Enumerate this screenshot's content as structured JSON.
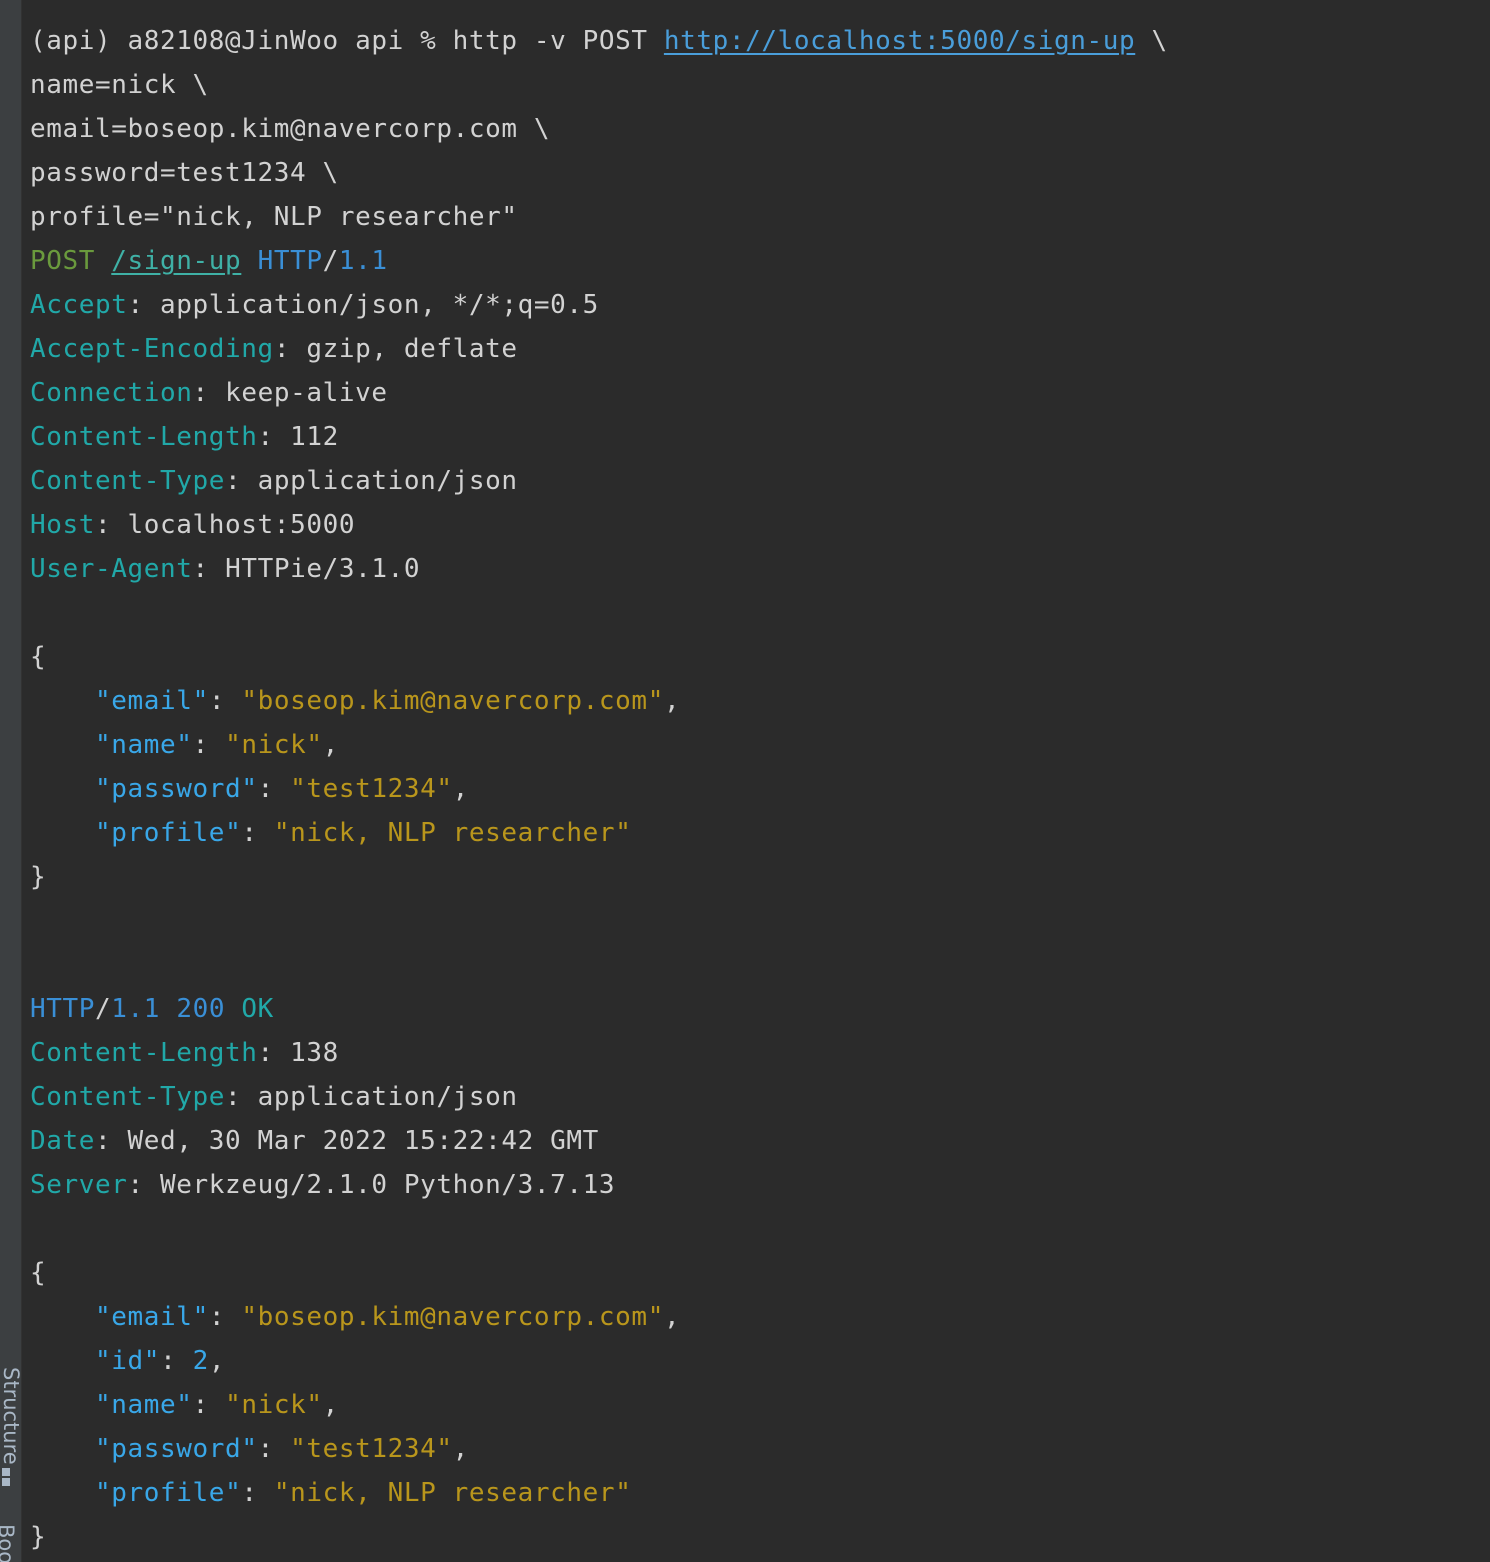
{
  "sidebar": {
    "structure_label": "Structure",
    "bookmarks_label": "Bookmarks"
  },
  "command": {
    "prompt": "(api) a82108@JinWoo api % ",
    "cmd": "http -v POST ",
    "url": "http://localhost:5000/sign-up",
    "cont": " \\",
    "args": [
      "name=nick \\",
      "email=boseop.kim@navercorp.com \\",
      "password=test1234 \\",
      "profile=\"nick, NLP researcher\""
    ]
  },
  "request": {
    "method": "POST",
    "path": "/sign-up",
    "protocol": "HTTP",
    "version": "1.1",
    "headers": [
      {
        "name": "Accept",
        "value": "application/json, */*;q=0.5"
      },
      {
        "name": "Accept-Encoding",
        "value": "gzip, deflate"
      },
      {
        "name": "Connection",
        "value": "keep-alive"
      },
      {
        "name": "Content-Length",
        "value": "112"
      },
      {
        "name": "Content-Type",
        "value": "application/json"
      },
      {
        "name": "Host",
        "value": "localhost:5000"
      },
      {
        "name": "User-Agent",
        "value": "HTTPie/3.1.0"
      }
    ],
    "body": [
      {
        "key": "email",
        "value": "boseop.kim@navercorp.com",
        "type": "string"
      },
      {
        "key": "name",
        "value": "nick",
        "type": "string"
      },
      {
        "key": "password",
        "value": "test1234",
        "type": "string"
      },
      {
        "key": "profile",
        "value": "nick, NLP researcher",
        "type": "string"
      }
    ]
  },
  "response": {
    "protocol": "HTTP",
    "version": "1.1",
    "status_code": "200",
    "status_text": "OK",
    "headers": [
      {
        "name": "Content-Length",
        "value": "138"
      },
      {
        "name": "Content-Type",
        "value": "application/json"
      },
      {
        "name": "Date",
        "value": "Wed, 30 Mar 2022 15:22:42 GMT"
      },
      {
        "name": "Server",
        "value": "Werkzeug/2.1.0 Python/3.7.13"
      }
    ],
    "body": [
      {
        "key": "email",
        "value": "boseop.kim@navercorp.com",
        "type": "string"
      },
      {
        "key": "id",
        "value": "2",
        "type": "number"
      },
      {
        "key": "name",
        "value": "nick",
        "type": "string"
      },
      {
        "key": "password",
        "value": "test1234",
        "type": "string"
      },
      {
        "key": "profile",
        "value": "nick, NLP researcher",
        "type": "string"
      }
    ]
  },
  "json": {
    "open_brace": "{",
    "close_brace": "}"
  },
  "colors": {
    "background": "#2b2b2b",
    "text": "#d2d2d2",
    "link": "#4a9eda",
    "method": "#6a9a3d",
    "header_name": "#21a8a8",
    "json_key": "#39a7e8",
    "json_string": "#b9961c"
  }
}
